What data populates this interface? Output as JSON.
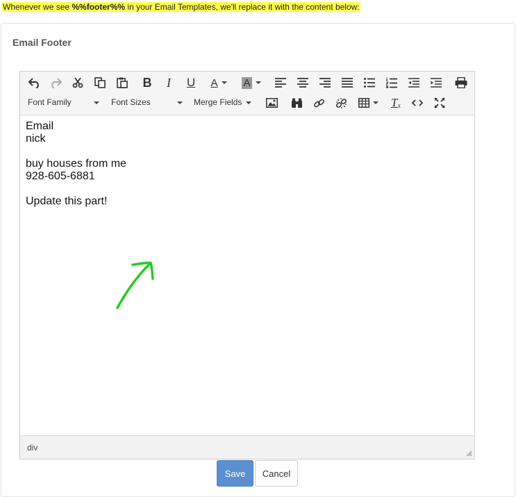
{
  "notice": {
    "before": "Whenever we see ",
    "token": "%%footer%%",
    "after": " in your Email Templates, we'll replace it with the content below:"
  },
  "panel": {
    "title": "Email Footer"
  },
  "toolbar": {
    "font_family": "Font Family",
    "font_sizes": "Font Sizes",
    "merge_fields": "Merge Fields",
    "bold": "B",
    "italic": "I",
    "underline": "U",
    "font_color": "A",
    "back_color": "A",
    "clear_format": "T"
  },
  "editor": {
    "lines": [
      "Email",
      "nick",
      "",
      "buy houses from me",
      "928-605-6881",
      "",
      "Update this part!"
    ],
    "status_path": "div"
  },
  "buttons": {
    "save": "Save",
    "cancel": "Cancel"
  },
  "colors": {
    "highlight": "#ffff4d",
    "save_button": "#5b8fd0",
    "arrow": "#22cc22"
  }
}
